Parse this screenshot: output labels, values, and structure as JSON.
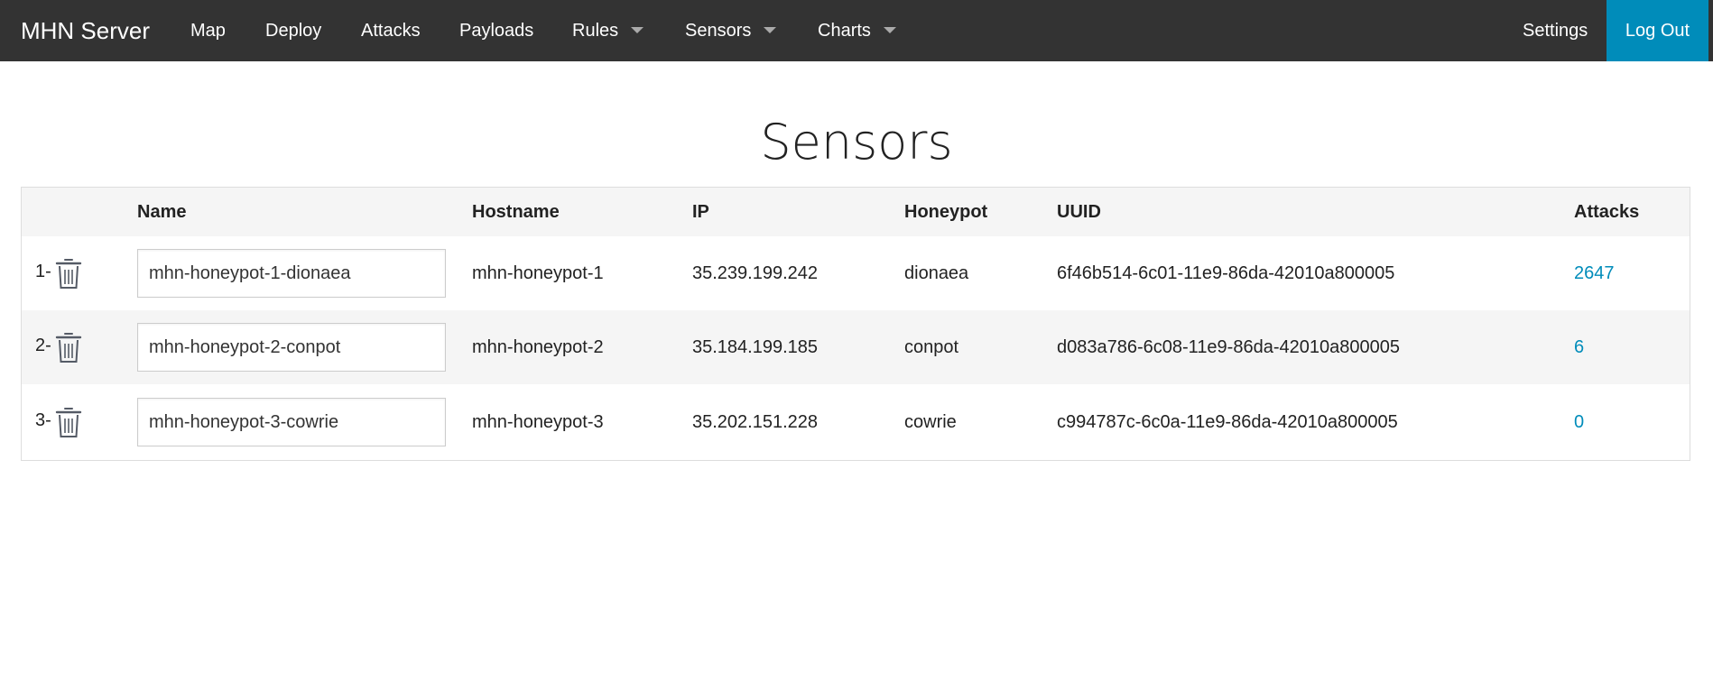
{
  "nav": {
    "brand": "MHN Server",
    "items": [
      {
        "label": "Map"
      },
      {
        "label": "Deploy"
      },
      {
        "label": "Attacks"
      },
      {
        "label": "Payloads"
      },
      {
        "label": "Rules"
      },
      {
        "label": "Sensors"
      },
      {
        "label": "Charts"
      }
    ],
    "settings": "Settings",
    "logout": "Log Out"
  },
  "page": {
    "title": "Sensors"
  },
  "table": {
    "headers": {
      "name": "Name",
      "hostname": "Hostname",
      "ip": "IP",
      "honeypot": "Honeypot",
      "uuid": "UUID",
      "attacks": "Attacks"
    },
    "rows": [
      {
        "index": "1-",
        "name": "mhn-honeypot-1-dionaea",
        "hostname": "mhn-honeypot-1",
        "ip": "35.239.199.242",
        "honeypot": "dionaea",
        "uuid": "6f46b514-6c01-11e9-86da-42010a800005",
        "attacks": "2647"
      },
      {
        "index": "2-",
        "name": "mhn-honeypot-2-conpot",
        "hostname": "mhn-honeypot-2",
        "ip": "35.184.199.185",
        "honeypot": "conpot",
        "uuid": "d083a786-6c08-11e9-86da-42010a800005",
        "attacks": "6"
      },
      {
        "index": "3-",
        "name": "mhn-honeypot-3-cowrie",
        "hostname": "mhn-honeypot-3",
        "ip": "35.202.151.228",
        "honeypot": "cowrie",
        "uuid": "c994787c-6c0a-11e9-86da-42010a800005",
        "attacks": "0"
      }
    ]
  },
  "colors": {
    "navbar": "#333333",
    "accent": "#008cba",
    "row_stripe": "#f5f5f5"
  },
  "icons": {
    "delete": "trash-icon",
    "dropdown": "caret-down-icon"
  }
}
